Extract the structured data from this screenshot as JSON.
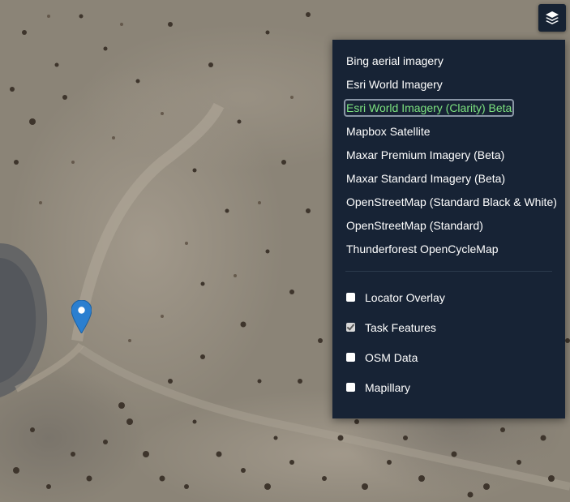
{
  "base_layers": [
    {
      "label": "Bing aerial imagery",
      "selected": false
    },
    {
      "label": "Esri World Imagery",
      "selected": false
    },
    {
      "label": "Esri World Imagery (Clarity) Beta",
      "selected": true
    },
    {
      "label": "Mapbox Satellite",
      "selected": false
    },
    {
      "label": "Maxar Premium Imagery (Beta)",
      "selected": false
    },
    {
      "label": "Maxar Standard Imagery (Beta)",
      "selected": false
    },
    {
      "label": "OpenStreetMap (Standard Black & White)",
      "selected": false
    },
    {
      "label": "OpenStreetMap (Standard)",
      "selected": false
    },
    {
      "label": "Thunderforest OpenCycleMap",
      "selected": false
    }
  ],
  "overlays": [
    {
      "label": "Locator Overlay",
      "checked": false
    },
    {
      "label": "Task Features",
      "checked": true
    },
    {
      "label": "OSM Data",
      "checked": false
    },
    {
      "label": "Mapillary",
      "checked": false
    }
  ],
  "icons": {
    "layer_toggle": "layers-icon",
    "marker": "map-pin-icon"
  },
  "colors": {
    "panel_background": "#172335",
    "selected_layer_text": "#7ce27f",
    "marker": "#2b7fd0",
    "terrain": "#8c8578"
  }
}
